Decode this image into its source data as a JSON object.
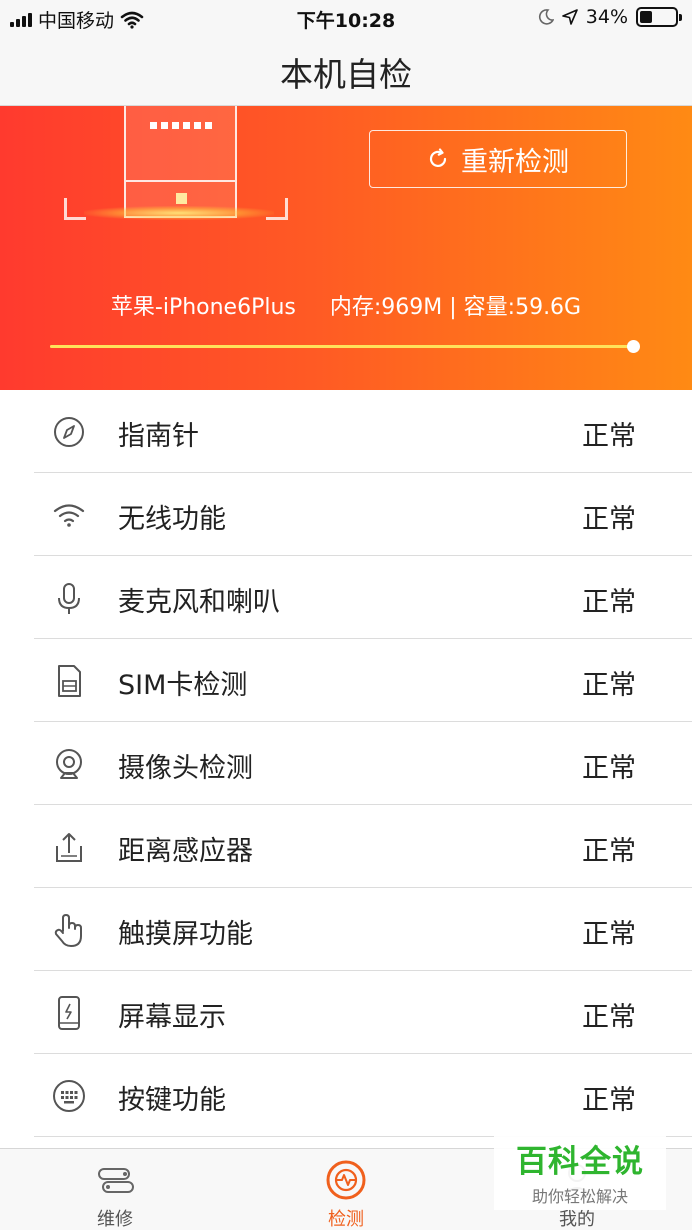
{
  "status_bar": {
    "carrier": "中国移动",
    "time": "下午10:28",
    "battery": "34%",
    "battery_level": 0.34
  },
  "nav": {
    "title": "本机自检"
  },
  "hero": {
    "recheck_label": "重新检测",
    "device_name": "苹果-iPhone6Plus",
    "memory_storage": "内存:969M | 容量:59.6G",
    "progress": 1.0
  },
  "checks": [
    {
      "label": "指南针",
      "status": "正常",
      "icon": "compass-icon"
    },
    {
      "label": "无线功能",
      "status": "正常",
      "icon": "wifi-icon"
    },
    {
      "label": "麦克风和喇叭",
      "status": "正常",
      "icon": "microphone-icon"
    },
    {
      "label": "SIM卡检测",
      "status": "正常",
      "icon": "sim-card-icon"
    },
    {
      "label": "摄像头检测",
      "status": "正常",
      "icon": "camera-icon"
    },
    {
      "label": "距离感应器",
      "status": "正常",
      "icon": "proximity-sensor-icon"
    },
    {
      "label": "触摸屏功能",
      "status": "正常",
      "icon": "touch-hand-icon"
    },
    {
      "label": "屏幕显示",
      "status": "正常",
      "icon": "screen-display-icon"
    },
    {
      "label": "按键功能",
      "status": "正常",
      "icon": "keyboard-icon"
    }
  ],
  "tabs": [
    {
      "label": "维修",
      "icon": "repair-tools-icon",
      "active": false
    },
    {
      "label": "检测",
      "icon": "detect-icon",
      "active": true
    },
    {
      "label": "我的",
      "icon": "profile-icon",
      "active": false
    }
  ],
  "watermark": {
    "title": "百科全说",
    "subtitle": "助你轻松解决"
  },
  "colors": {
    "accent": "#f0601d",
    "hero_start": "#ff3a2e",
    "hero_end": "#ff8a14",
    "watermark_green": "#2fb52f"
  }
}
